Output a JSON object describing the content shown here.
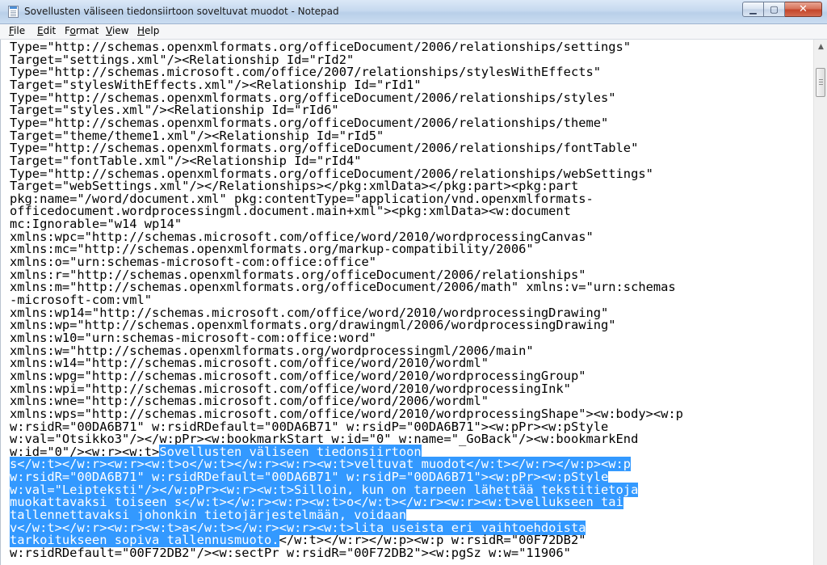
{
  "window": {
    "title": "Sovellusten väliseen tiedonsiirtoon soveltuvat muodot - Notepad",
    "controls": {
      "minimize": "▁",
      "maximize": "▢",
      "close": "✕"
    }
  },
  "menu": [
    "File",
    "Edit",
    "Format",
    "View",
    "Help"
  ],
  "editor": {
    "lines": [
      [
        {
          "t": "Type=\"http://schemas.openxmlformats.org/officeDocument/2006/relationships/settings\""
        }
      ],
      [
        {
          "t": "Target=\"settings.xml\"/><Relationship Id=\"rId2\""
        }
      ],
      [
        {
          "t": "Type=\"http://schemas.microsoft.com/office/2007/relationships/stylesWithEffects\""
        }
      ],
      [
        {
          "t": "Target=\"stylesWithEffects.xml\"/><Relationship Id=\"rId1\""
        }
      ],
      [
        {
          "t": "Type=\"http://schemas.openxmlformats.org/officeDocument/2006/relationships/styles\""
        }
      ],
      [
        {
          "t": "Target=\"styles.xml\"/><Relationship Id=\"rId6\""
        }
      ],
      [
        {
          "t": "Type=\"http://schemas.openxmlformats.org/officeDocument/2006/relationships/theme\""
        }
      ],
      [
        {
          "t": "Target=\"theme/theme1.xml\"/><Relationship Id=\"rId5\""
        }
      ],
      [
        {
          "t": "Type=\"http://schemas.openxmlformats.org/officeDocument/2006/relationships/fontTable\""
        }
      ],
      [
        {
          "t": "Target=\"fontTable.xml\"/><Relationship Id=\"rId4\""
        }
      ],
      [
        {
          "t": "Type=\"http://schemas.openxmlformats.org/officeDocument/2006/relationships/webSettings\""
        }
      ],
      [
        {
          "t": "Target=\"webSettings.xml\"/></Relationships></pkg:xmlData></pkg:part><pkg:part"
        }
      ],
      [
        {
          "t": "pkg:name=\"/word/document.xml\" pkg:contentType=\"application/vnd.openxmlformats-"
        }
      ],
      [
        {
          "t": "officedocument.wordprocessingml.document.main+xml\"><pkg:xmlData><w:document"
        }
      ],
      [
        {
          "t": "mc:Ignorable=\"w14 wp14\""
        }
      ],
      [
        {
          "t": "xmlns:wpc=\"http://schemas.microsoft.com/office/word/2010/wordprocessingCanvas\""
        }
      ],
      [
        {
          "t": "xmlns:mc=\"http://schemas.openxmlformats.org/markup-compatibility/2006\""
        }
      ],
      [
        {
          "t": "xmlns:o=\"urn:schemas-microsoft-com:office:office\""
        }
      ],
      [
        {
          "t": "xmlns:r=\"http://schemas.openxmlformats.org/officeDocument/2006/relationships\""
        }
      ],
      [
        {
          "t": "xmlns:m=\"http://schemas.openxmlformats.org/officeDocument/2006/math\" xmlns:v=\"urn:schemas"
        }
      ],
      [
        {
          "t": "-microsoft-com:vml\""
        }
      ],
      [
        {
          "t": "xmlns:wp14=\"http://schemas.microsoft.com/office/word/2010/wordprocessingDrawing\""
        }
      ],
      [
        {
          "t": "xmlns:wp=\"http://schemas.openxmlformats.org/drawingml/2006/wordprocessingDrawing\""
        }
      ],
      [
        {
          "t": "xmlns:w10=\"urn:schemas-microsoft-com:office:word\""
        }
      ],
      [
        {
          "t": "xmlns:w=\"http://schemas.openxmlformats.org/wordprocessingml/2006/main\""
        }
      ],
      [
        {
          "t": "xmlns:w14=\"http://schemas.microsoft.com/office/word/2010/wordml\""
        }
      ],
      [
        {
          "t": "xmlns:wpg=\"http://schemas.microsoft.com/office/word/2010/wordprocessingGroup\""
        }
      ],
      [
        {
          "t": "xmlns:wpi=\"http://schemas.microsoft.com/office/word/2010/wordprocessingInk\""
        }
      ],
      [
        {
          "t": "xmlns:wne=\"http://schemas.microsoft.com/office/word/2006/wordml\""
        }
      ],
      [
        {
          "t": "xmlns:wps=\"http://schemas.microsoft.com/office/word/2010/wordprocessingShape\"><w:body><w:p"
        }
      ],
      [
        {
          "t": "w:rsidR=\"00DA6B71\" w:rsidRDefault=\"00DA6B71\" w:rsidP=\"00DA6B71\"><w:pPr><w:pStyle"
        }
      ],
      [
        {
          "t": "w:val=\"Otsikko3\"/></w:pPr><w:bookmarkStart w:id=\"0\" w:name=\"_GoBack\"/><w:bookmarkEnd"
        }
      ],
      [
        {
          "t": "w:id=\"0\"/><w:r><w:t>"
        },
        {
          "t": "Sovellusten väliseen tiedonsiirtoon",
          "sel": true
        }
      ],
      [
        {
          "t": "s</w:t></w:r><w:r><w:t>o</w:t></w:r><w:r><w:t>veltuvat muodot</w:t></w:r></w:p><w:p",
          "sel": true
        }
      ],
      [
        {
          "t": "w:rsidR=\"00DA6B71\" w:rsidRDefault=\"00DA6B71\" w:rsidP=\"00DA6B71\"><w:pPr><w:pStyle",
          "sel": true
        }
      ],
      [
        {
          "t": "w:val=\"Leipteksti\"/></w:pPr><w:r><w:t>Silloin, kun on tarpeen lähettää tekstitietoja",
          "sel": true
        }
      ],
      [
        {
          "t": "muokattavaksi toiseen s</w:t></w:r><w:r><w:t>o</w:t></w:r><w:r><w:t>vellukseen tai",
          "sel": true
        }
      ],
      [
        {
          "t": "tallennettavaksi johonkin tietojärjestelmään, voidaan",
          "sel": true
        }
      ],
      [
        {
          "t": "v</w:t></w:r><w:r><w:t>a</w:t></w:r><w:r><w:t>lita useista eri vaihtoehdoista",
          "sel": true
        }
      ],
      [
        {
          "t": "tarkoitukseen sopiva tallennusmuoto.",
          "sel": true
        },
        {
          "t": "</w:t></w:r></w:p><w:p w:rsidR=\"00F72DB2\""
        }
      ],
      [
        {
          "t": "w:rsidRDefault=\"00F72DB2\"/><w:sectPr w:rsidR=\"00F72DB2\"><w:pgSz w:w=\"11906\""
        }
      ]
    ]
  },
  "colors": {
    "selection": "#3399ff",
    "selection_text": "#ffffff"
  }
}
